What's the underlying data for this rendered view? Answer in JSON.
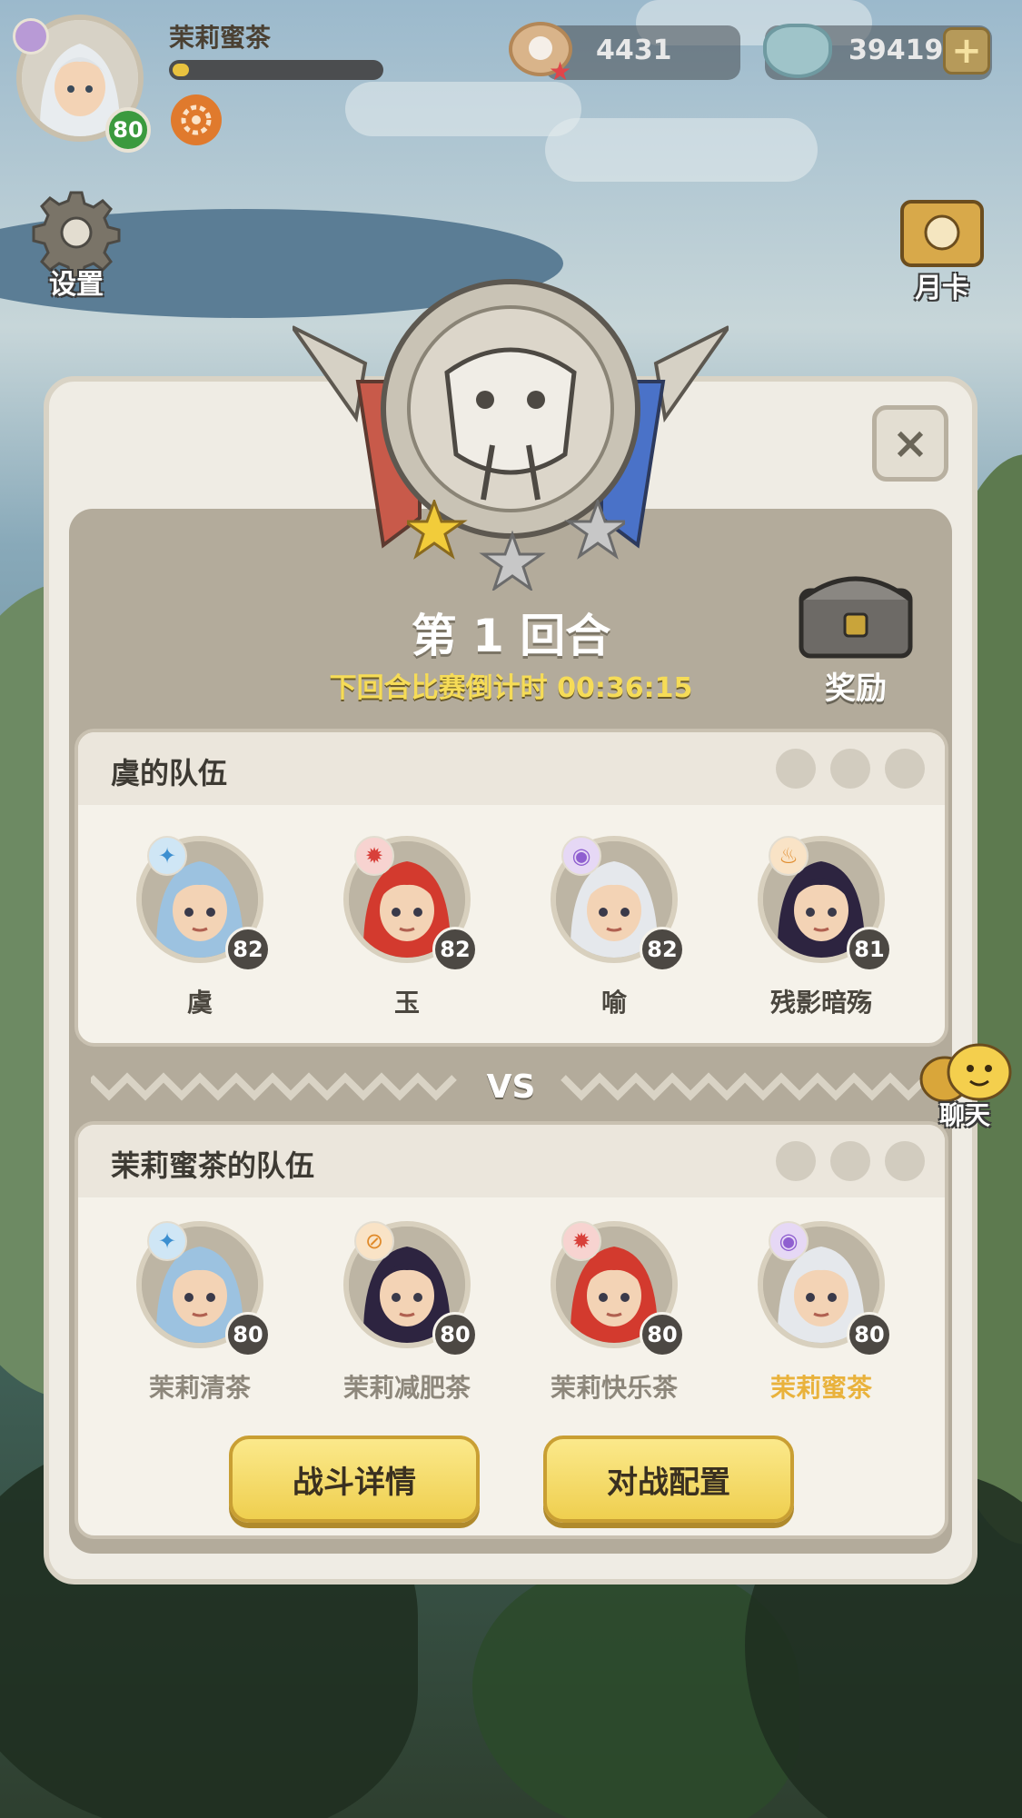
{
  "hud": {
    "player_name": "茉莉蜜茶",
    "player_level": "80",
    "xp_fraction": 0.08,
    "currency_shell": "4431",
    "currency_pearl": "39419",
    "plus_label": "+"
  },
  "side": {
    "settings_label": "设置",
    "monthly_card_label": "月卡",
    "chat_label": "聊天"
  },
  "dialog": {
    "round_title": "第 1 回合",
    "countdown_text": "下回合比赛倒计时 00:36:15",
    "reward_label": "奖励",
    "close_label": "×",
    "vs_label": "VS",
    "stars_earned": 1,
    "stars_total": 3
  },
  "team_a": {
    "name": "虞的队伍",
    "members": [
      {
        "name": "虞",
        "level": "82",
        "element": "water"
      },
      {
        "name": "玉",
        "level": "82",
        "element": "fire"
      },
      {
        "name": "喻",
        "level": "82",
        "element": "shadow"
      },
      {
        "name": "残影暗殇",
        "level": "81",
        "element": "flame"
      }
    ]
  },
  "team_b": {
    "name": "茉莉蜜茶的队伍",
    "members": [
      {
        "name": "茉莉清茶",
        "level": "80",
        "element": "water"
      },
      {
        "name": "茉莉减肥茶",
        "level": "80",
        "element": "disabled"
      },
      {
        "name": "茉莉快乐茶",
        "level": "80",
        "element": "fire"
      },
      {
        "name": "茉莉蜜茶",
        "level": "80",
        "element": "shadow"
      }
    ]
  },
  "buttons": {
    "battle_details": "战斗详情",
    "battle_config": "对战配置"
  },
  "colors": {
    "accent_yellow": "#efcf4f",
    "highlight_name": "#e9b23c",
    "countdown": "#f6dc57"
  }
}
